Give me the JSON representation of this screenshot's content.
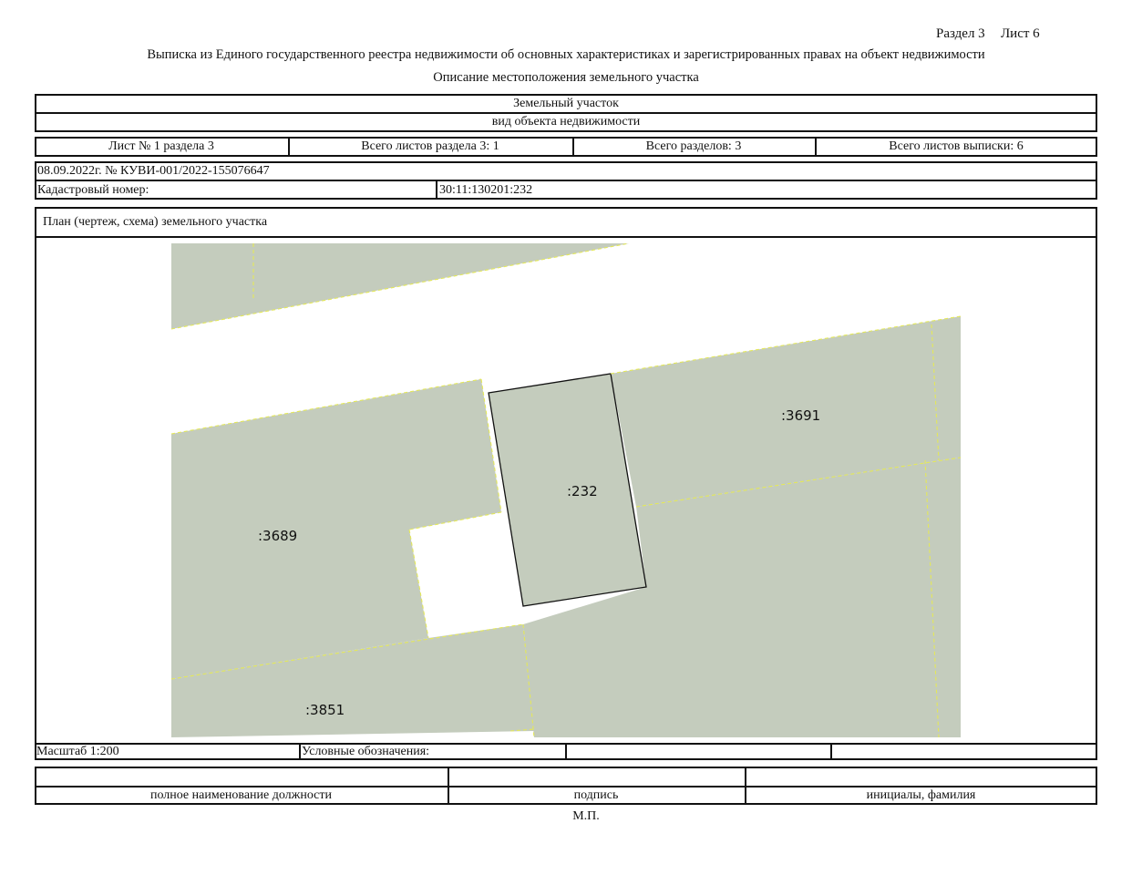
{
  "header": {
    "section_label": "Раздел 3",
    "sheet_label": "Лист 6",
    "title": "Выписка из Единого государственного реестра недвижимости об основных характеристиках и зарегистрированных правах на объект недвижимости",
    "subtitle": "Описание местоположения земельного участка"
  },
  "object": {
    "type_value": "Земельный участок",
    "type_caption": "вид объекта недвижимости"
  },
  "sheets_row": {
    "sheet_of_section": "Лист № 1 раздела 3",
    "total_sheets_section": "Всего листов раздела 3: 1",
    "total_sections": "Всего разделов: 3",
    "total_sheets_extract": "Всего листов выписки: 6"
  },
  "document": {
    "date_number": "08.09.2022г. № КУВИ-001/2022-155076647",
    "cadastral_label": "Кадастровый номер:",
    "cadastral_value": "30:11:130201:232"
  },
  "plan": {
    "heading": "План (чертеж, схема) земельного участка",
    "parcel_labels": {
      "target": ":232",
      "north_east": ":3691",
      "west": ":3689",
      "south": ":3851"
    },
    "colors": {
      "parcel_fill": "#c4ccbd",
      "boundary_yellow": "#e4e85a",
      "target_outline": "#111111"
    }
  },
  "footer": {
    "scale": "Масштаб 1:200",
    "legend_label": "Условные обозначения:",
    "position_caption": "полное наименование должности",
    "signature_caption": "подпись",
    "initials_caption": "инициалы, фамилия",
    "stamp": "М.П."
  }
}
